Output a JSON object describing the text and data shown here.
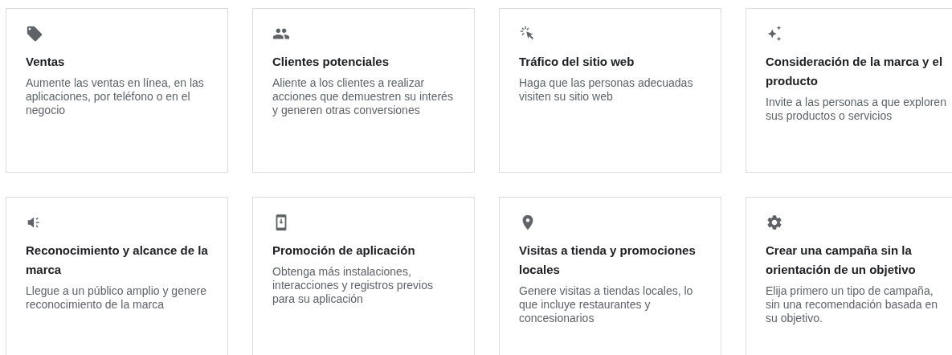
{
  "cards": [
    {
      "title": "Ventas",
      "description": "Aumente las ventas en línea, en las aplicaciones, por teléfono o en el negocio"
    },
    {
      "title": "Clientes potenciales",
      "description": "Aliente a los clientes a realizar acciones que demuestren su interés y generen otras conversiones"
    },
    {
      "title": "Tráfico del sitio web",
      "description": "Haga que las personas adecuadas visiten su sitio web"
    },
    {
      "title": "Consideración de la marca y el producto",
      "description": "Invite a las personas a que exploren sus productos o servicios"
    },
    {
      "title": "Reconocimiento y alcance de la marca",
      "description": "Llegue a un público amplio y genere reconocimiento de la marca"
    },
    {
      "title": "Promoción de aplicación",
      "description": "Obtenga más instalaciones, interacciones y registros previos para su aplicación"
    },
    {
      "title": "Visitas a tienda y promociones locales",
      "description": "Genere visitas a tiendas locales, lo que incluye restaurantes y concesionarios"
    },
    {
      "title": "Crear una campaña sin la orientación de un objetivo",
      "description": "Elija primero un tipo de campaña, sin una recomendación basada en su objetivo."
    }
  ]
}
